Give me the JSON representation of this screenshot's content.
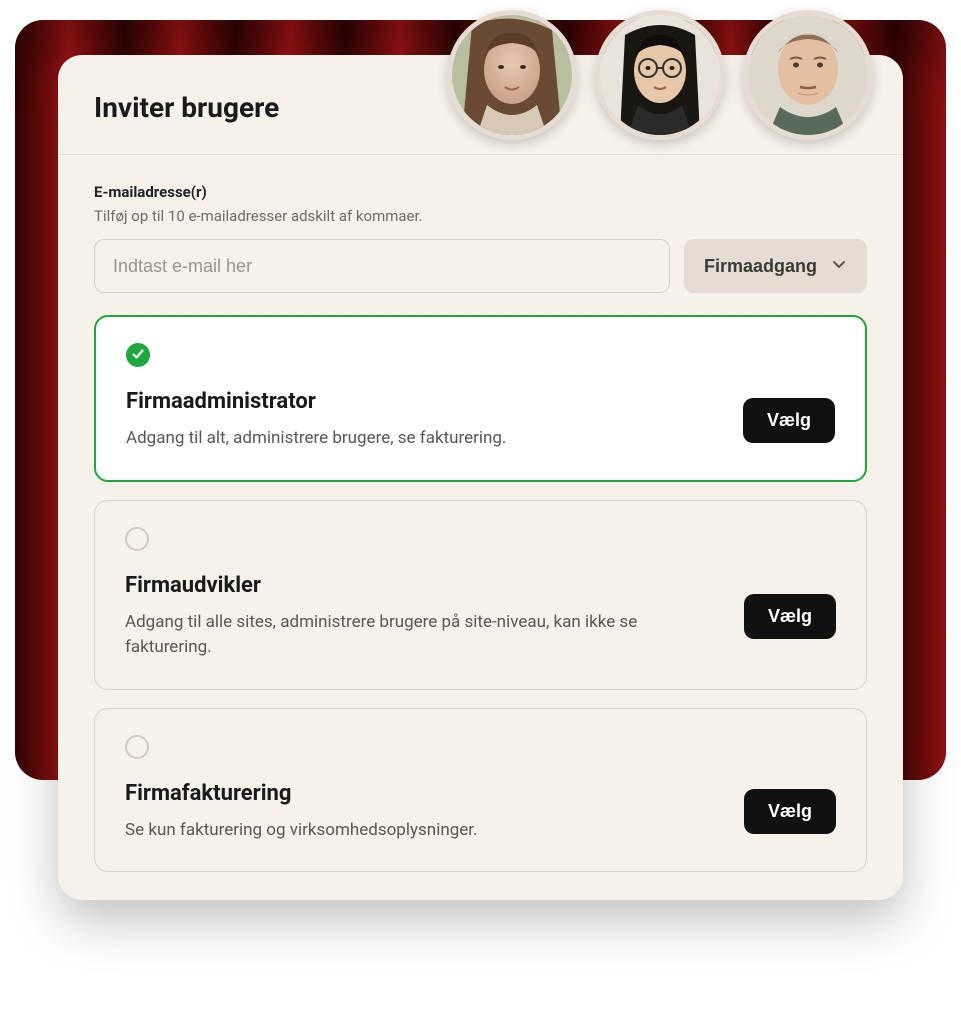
{
  "header": {
    "title": "Inviter brugere"
  },
  "email": {
    "label": "E-mailadresse(r)",
    "hint": "Tilføj op til 10 e-mailadresser adskilt af kommaer.",
    "placeholder": "Indtast e-mail her"
  },
  "dropdown": {
    "selected": "Firmaadgang"
  },
  "roles": [
    {
      "title": "Firmaadministrator",
      "description": "Adgang til alt, administrere brugere, se fakturering.",
      "button": "Vælg",
      "selected": true
    },
    {
      "title": "Firmaudvikler",
      "description": "Adgang til alle sites, administrere brugere på site-niveau, kan ikke se fakturering.",
      "button": "Vælg",
      "selected": false
    },
    {
      "title": "Firmafakturering",
      "description": "Se kun fakturering og virksomhedsoplysninger.",
      "button": "Vælg",
      "selected": false
    }
  ]
}
